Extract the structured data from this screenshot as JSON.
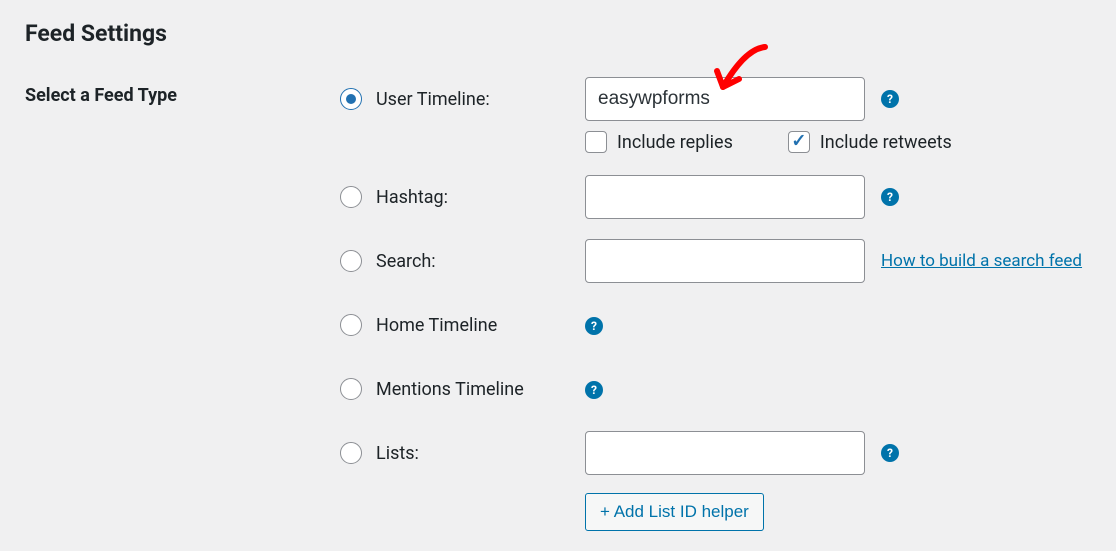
{
  "heading": "Feed Settings",
  "section_label": "Select a Feed Type",
  "feed_types": {
    "user_timeline": {
      "label": "User Timeline:",
      "value": "easywpforms"
    },
    "hashtag": {
      "label": "Hashtag:",
      "value": ""
    },
    "search": {
      "label": "Search:",
      "value": ""
    },
    "home_timeline": {
      "label": "Home Timeline"
    },
    "mentions_timeline": {
      "label": "Mentions Timeline"
    },
    "lists": {
      "label": "Lists:",
      "value": ""
    }
  },
  "sub_options": {
    "include_replies": "Include replies",
    "include_retweets": "Include retweets"
  },
  "links": {
    "search_help": "How to build a search feed"
  },
  "buttons": {
    "list_helper": "+ Add List ID helper"
  },
  "help_glyph": "?"
}
